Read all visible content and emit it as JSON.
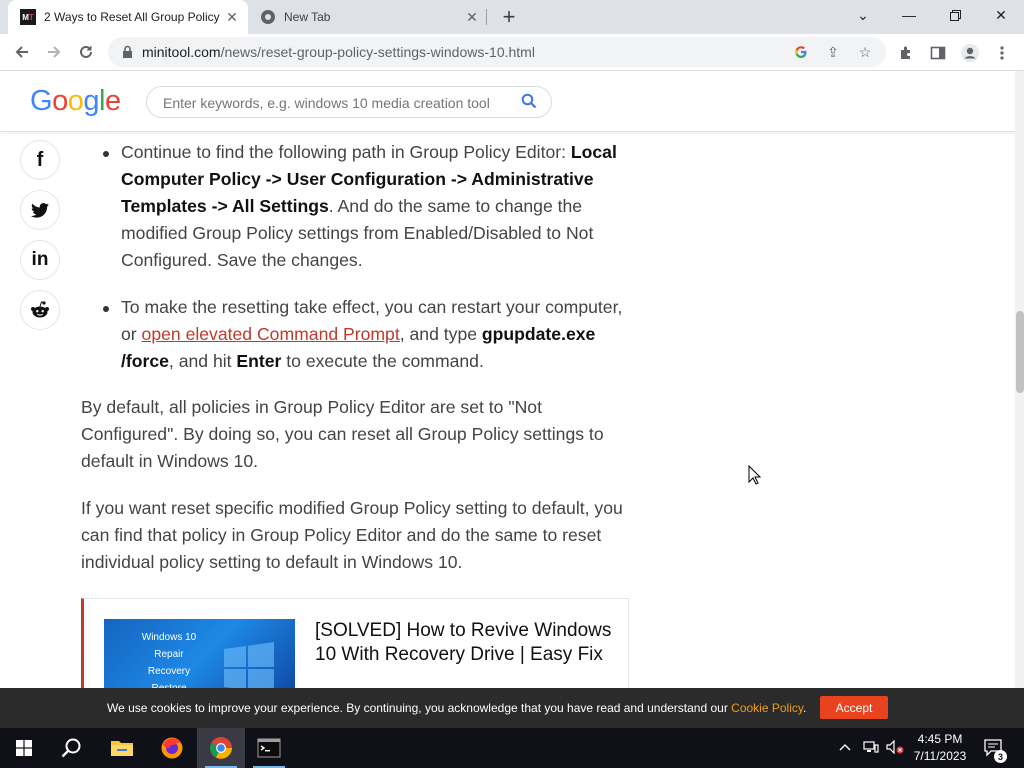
{
  "browser": {
    "tabs": [
      {
        "title": "2 Ways to Reset All Group Policy",
        "favicon": "minitool-icon",
        "active": true
      },
      {
        "title": "New Tab",
        "favicon": "chrome-icon",
        "active": false
      }
    ],
    "url_domain": "minitool.com",
    "url_path": "/news/reset-group-policy-settings-windows-10.html"
  },
  "site": {
    "logo": "Google",
    "search_placeholder": "Enter keywords, e.g. windows 10 media creation tool"
  },
  "social": [
    "facebook-icon",
    "twitter-icon",
    "linkedin-icon",
    "reddit-icon"
  ],
  "article": {
    "bullet1": {
      "pre": "Continue to find the following path in Group Policy Editor: ",
      "bold": "Local Computer Policy -> User Configuration -> Administrative Templates -> All Settings",
      "post": ". And do the same to change the modified Group Policy settings from Enabled/Disabled to Not Configured. Save the changes."
    },
    "bullet2": {
      "pre": "To make the resetting take effect, you can restart your computer, or ",
      "link": "open elevated Command Prompt",
      "mid": ", and type ",
      "bold1": "gpupdate.exe /force",
      "mid2": ", and hit ",
      "bold2": "Enter",
      "post": " to execute the command."
    },
    "para1": "By default, all policies in Group Policy Editor are set to \"Not Configured\". By doing so, you can reset all Group Policy settings to default in Windows 10.",
    "para2": "If you want reset specific modified Group Policy setting to default, you can find that policy in Group Policy Editor and do the same to reset individual policy setting to default in Windows 10.",
    "card": {
      "title": "[SOLVED] How to Revive Windows 10 With Recovery Drive | Easy Fix",
      "thumb_lines": [
        "Windows 10",
        "Repair",
        "Recovery",
        "Restore"
      ]
    }
  },
  "cookie": {
    "text": "We use cookies to improve your experience. By continuing, you acknowledge that you have read and understand our ",
    "link": "Cookie Policy",
    "end": ".",
    "accept": "Accept"
  },
  "taskbar": {
    "time": "4:45 PM",
    "date": "7/11/2023",
    "notification_count": "3"
  }
}
